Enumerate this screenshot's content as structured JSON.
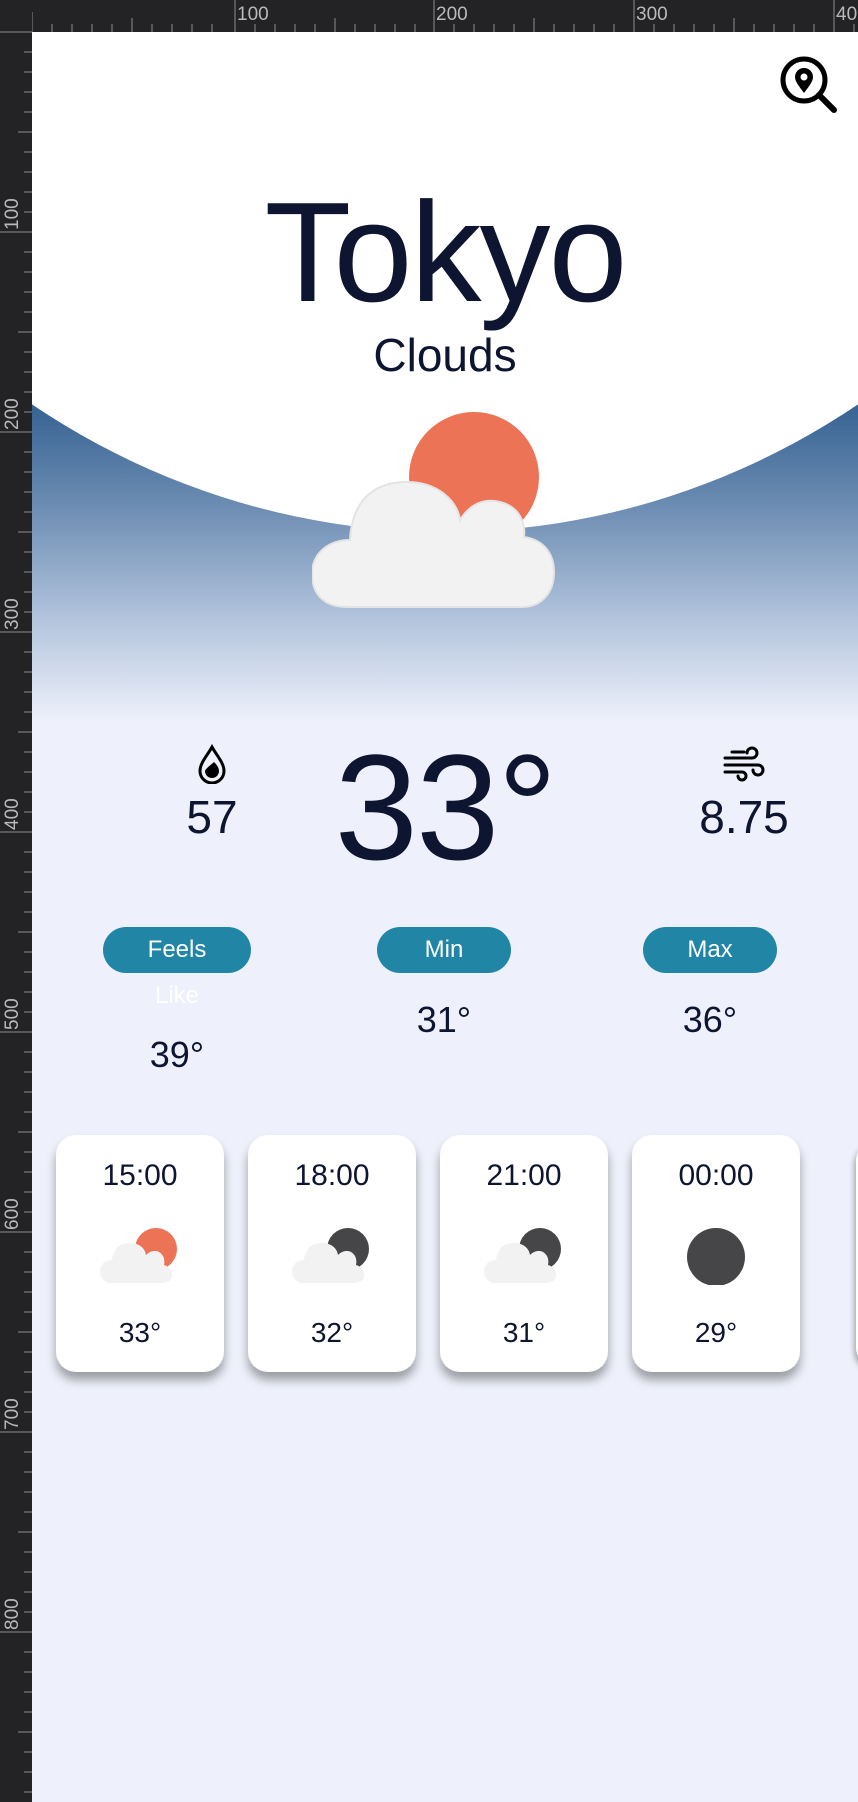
{
  "ruler": {
    "top_labels": [
      "100",
      "200",
      "300",
      "40"
    ],
    "left_labels": [
      "100",
      "200",
      "300",
      "400",
      "500",
      "600",
      "700",
      "800"
    ]
  },
  "weather": {
    "city": "Tokyo",
    "condition": "Clouds",
    "condition_icon": "clouds-sun-icon",
    "temperature": "33°",
    "humidity": "57",
    "wind": "8.75",
    "feels_like_label": "Feels Like",
    "feels_like": "39°",
    "min_label": "Min",
    "min": "31°",
    "max_label": "Max",
    "max": "36°"
  },
  "forecast": [
    {
      "time": "15:00",
      "temp": "33°",
      "icon": "cloud-sun-icon"
    },
    {
      "time": "18:00",
      "temp": "32°",
      "icon": "cloud-moon-icon"
    },
    {
      "time": "21:00",
      "temp": "31°",
      "icon": "cloud-moon-icon"
    },
    {
      "time": "00:00",
      "temp": "29°",
      "icon": "moon-icon"
    }
  ],
  "colors": {
    "text": "#0d1530",
    "pill": "#2185a6",
    "sun": "#ec7355",
    "moon": "#464649",
    "cloud": "#f2f2f2",
    "background": "#eef1fb"
  }
}
